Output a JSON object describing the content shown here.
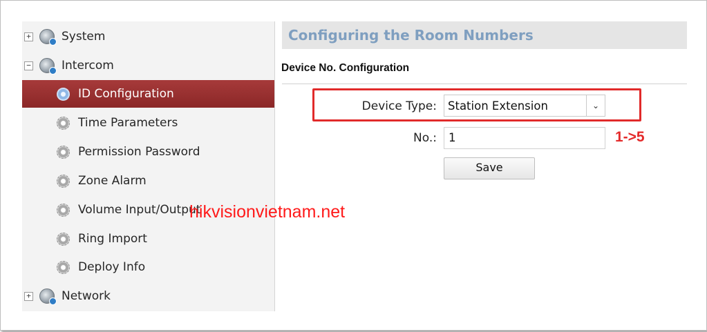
{
  "sidebar": {
    "system": "System",
    "intercom": "Intercom",
    "network": "Network",
    "items": [
      {
        "label": "ID Configuration"
      },
      {
        "label": "Time Parameters"
      },
      {
        "label": "Permission Password"
      },
      {
        "label": "Zone Alarm"
      },
      {
        "label": "Volume Input/Output"
      },
      {
        "label": "Ring Import"
      },
      {
        "label": "Deploy Info"
      }
    ],
    "expand_symbol": "+",
    "collapse_symbol": "−"
  },
  "main": {
    "title": "Configuring the Room Numbers",
    "section": "Device No. Configuration",
    "device_type_label": "Device Type:",
    "device_type_value": "Station Extension",
    "no_label": "No.:",
    "no_value": "1",
    "save_label": "Save",
    "dropdown_arrow": "⌄"
  },
  "annotations": {
    "range": "1->5",
    "watermark": "hikvisionvietnam.net",
    "highlight_color": "#e12a2a"
  }
}
